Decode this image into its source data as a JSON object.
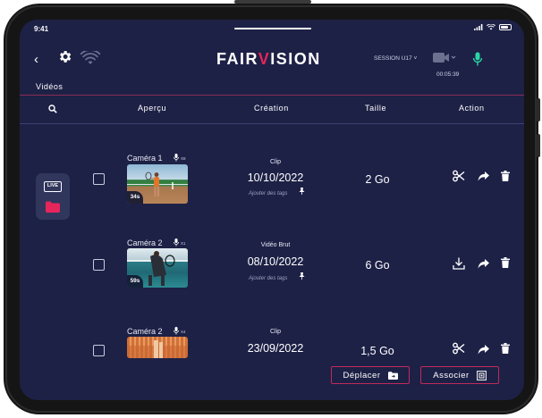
{
  "status_bar": {
    "time": "9:41"
  },
  "header": {
    "logo_left": "FAIR",
    "logo_accent": "V",
    "logo_right": "ISION",
    "session": "SESSION U17",
    "timer": "00:05:39"
  },
  "section_title": "Vidéos",
  "table": {
    "headers": [
      "Aperçu",
      "Création",
      "Taille",
      "Action"
    ],
    "rows": [
      {
        "camera": "Caméra 1",
        "mic_count": "X8",
        "duration": "34s",
        "type": "Clip",
        "date": "10/10/2022",
        "tags_placeholder": "Ajouter des tags",
        "size": "2 Go",
        "actions": [
          "scissors-icon",
          "share-icon",
          "trash-icon"
        ]
      },
      {
        "camera": "Caméra 2",
        "mic_count": "X1",
        "duration": "59s",
        "type": "Vidéo Brut",
        "date": "08/10/2022",
        "tags_placeholder": "Ajouter des tags",
        "size": "6 Go",
        "actions": [
          "download-icon",
          "share-icon",
          "trash-icon"
        ]
      },
      {
        "camera": "Caméra 2",
        "mic_count": "X4",
        "duration": "",
        "type": "Clip",
        "date": "23/09/2022",
        "tags_placeholder": "",
        "size": "1,5 Go",
        "actions": [
          "scissors-icon",
          "share-icon",
          "trash-icon"
        ]
      }
    ]
  },
  "sidebar": {
    "live_badge": "LIVE"
  },
  "buttons": {
    "move": "Déplacer",
    "associate": "Associer"
  },
  "colors": {
    "background": "#1d2146",
    "accent": "#e6255a",
    "mic_active": "#2bd4a4",
    "panel": "#30365c"
  }
}
